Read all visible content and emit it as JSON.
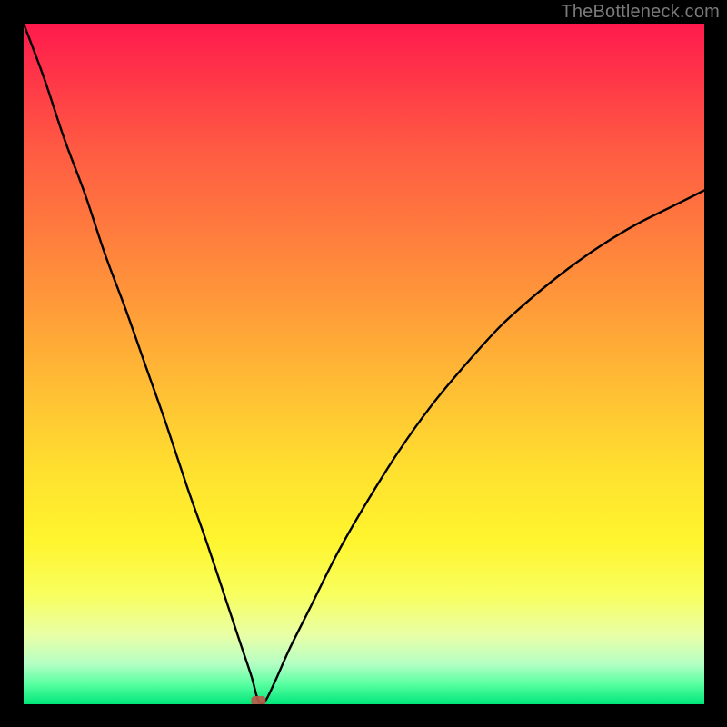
{
  "watermark": {
    "text": "TheBottleneck.com"
  },
  "chart_data": {
    "type": "line",
    "title": "",
    "xlabel": "",
    "ylabel": "",
    "xlim": [
      0,
      100
    ],
    "ylim": [
      0,
      100
    ],
    "grid": false,
    "legend": false,
    "annotations": [
      {
        "name": "marker",
        "x": 34.5,
        "y": 0,
        "color": "#b85a4a",
        "shape": "rounded-rect"
      }
    ],
    "series": [
      {
        "name": "bottleneck-curve",
        "color": "#000000",
        "x": [
          0,
          3,
          6,
          9,
          12,
          15,
          18,
          21,
          24,
          27,
          30,
          32,
          33.5,
          34.5,
          35.5,
          37,
          39,
          42,
          46,
          50,
          55,
          60,
          65,
          70,
          75,
          80,
          85,
          90,
          95,
          100
        ],
        "y": [
          100,
          92,
          83,
          75,
          66,
          58,
          49.5,
          41,
          32,
          23.5,
          14.5,
          8.5,
          4,
          0.5,
          0.5,
          3.5,
          8,
          14,
          22,
          29,
          37,
          44,
          50,
          55.5,
          60,
          64,
          67.5,
          70.5,
          73,
          75.5
        ]
      }
    ]
  }
}
